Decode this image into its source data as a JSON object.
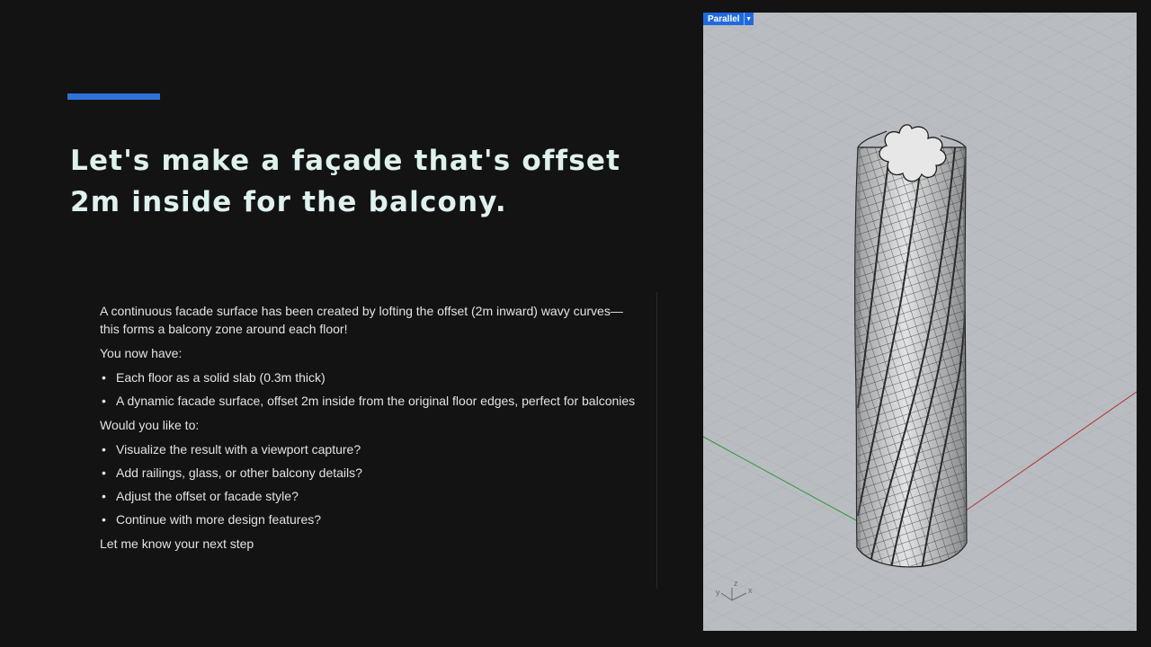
{
  "slide": {
    "title": "Let's make a façade that's offset 2m inside for the balcony."
  },
  "chat": {
    "intro": "A continuous facade surface has been created by lofting the offset (2m inward) wavy curves—this forms a balcony zone around each floor!",
    "have_heading": "You now have:",
    "have_items": [
      "Each floor as a solid slab (0.3m thick)",
      "A dynamic facade surface, offset 2m inside from the original floor edges, perfect for balconies"
    ],
    "options_heading": "Would you like to:",
    "options": [
      "Visualize the result with a viewport capture?",
      "Add railings, glass, or other balcony details?",
      "Adjust the offset or facade style?",
      "Continue with more design features?"
    ],
    "closing": "Let me know your next step",
    "bullet": "•"
  },
  "viewport": {
    "projection_label": "Parallel",
    "dropdown_icon": "▼",
    "axes": {
      "y": "y",
      "z": "z",
      "x": "x"
    }
  },
  "colors": {
    "accent": "#2f73d9",
    "title": "#dff1ee",
    "viewport_bg": "#b9bcc0",
    "viewport_label": "#1f6ae0",
    "x_axis": "#b03030",
    "y_axis": "#2e9a3a"
  }
}
